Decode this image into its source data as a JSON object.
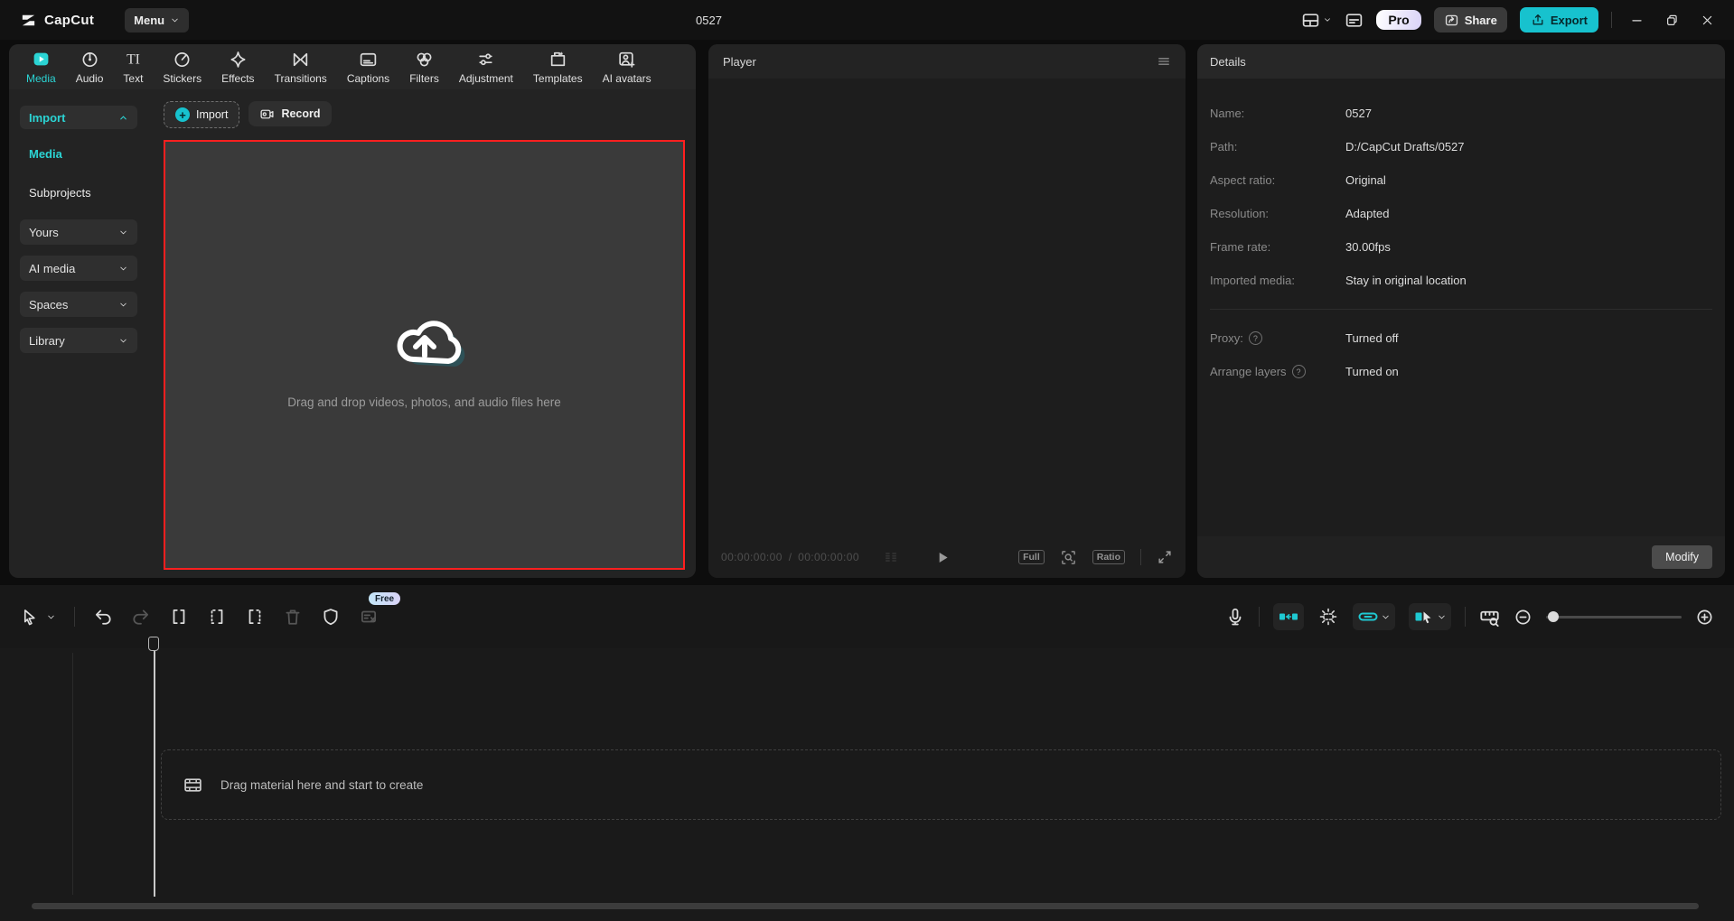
{
  "titlebar": {
    "app_name": "CapCut",
    "menu_label": "Menu",
    "project_title": "0527",
    "pro_label": "Pro",
    "share_label": "Share",
    "export_label": "Export"
  },
  "tabs": [
    {
      "label": "Media",
      "active": true
    },
    {
      "label": "Audio"
    },
    {
      "label": "Text"
    },
    {
      "label": "Stickers"
    },
    {
      "label": "Effects"
    },
    {
      "label": "Transitions"
    },
    {
      "label": "Captions"
    },
    {
      "label": "Filters"
    },
    {
      "label": "Adjustment"
    },
    {
      "label": "Templates"
    },
    {
      "label": "AI avatars"
    }
  ],
  "sidebar": {
    "items": [
      {
        "label": "Import",
        "state": "expanded"
      },
      {
        "label": "Media",
        "state": "selected"
      },
      {
        "label": "Subprojects"
      },
      {
        "label": "Yours",
        "state": "collapsed"
      },
      {
        "label": "AI media",
        "state": "collapsed"
      },
      {
        "label": "Spaces",
        "state": "collapsed"
      },
      {
        "label": "Library",
        "state": "collapsed"
      }
    ]
  },
  "media_panel": {
    "import_button": "Import",
    "record_button": "Record",
    "dropzone_text": "Drag and drop videos, photos, and audio files here"
  },
  "player": {
    "title": "Player",
    "current_time": "00:00:00:00",
    "time_separator": "/",
    "total_time": "00:00:00:00",
    "full_label": "Full",
    "ratio_label": "Ratio"
  },
  "details": {
    "title": "Details",
    "rows": [
      {
        "label": "Name:",
        "value": "0527"
      },
      {
        "label": "Path:",
        "value": "D:/CapCut Drafts/0527"
      },
      {
        "label": "Aspect ratio:",
        "value": "Original"
      },
      {
        "label": "Resolution:",
        "value": "Adapted"
      },
      {
        "label": "Frame rate:",
        "value": "30.00fps"
      },
      {
        "label": "Imported media:",
        "value": "Stay in original location"
      }
    ],
    "extra_rows": [
      {
        "label": "Proxy:",
        "value": "Turned off",
        "help": "?"
      },
      {
        "label": "Arrange layers",
        "value": "Turned on",
        "help": "?"
      }
    ],
    "modify_label": "Modify"
  },
  "toolbar": {
    "free_badge": "Free"
  },
  "timeline": {
    "empty_text": "Drag material here and start to create"
  },
  "colors": {
    "accent_teal": "#2bd4d4",
    "export_button_teal": "#17c2ce",
    "dropzone_border_red": "#ff1f1f",
    "pro_badge_gradient": "#d9d2f7",
    "panel_bg": "#232323",
    "page_bg": "#0d0d0d"
  }
}
